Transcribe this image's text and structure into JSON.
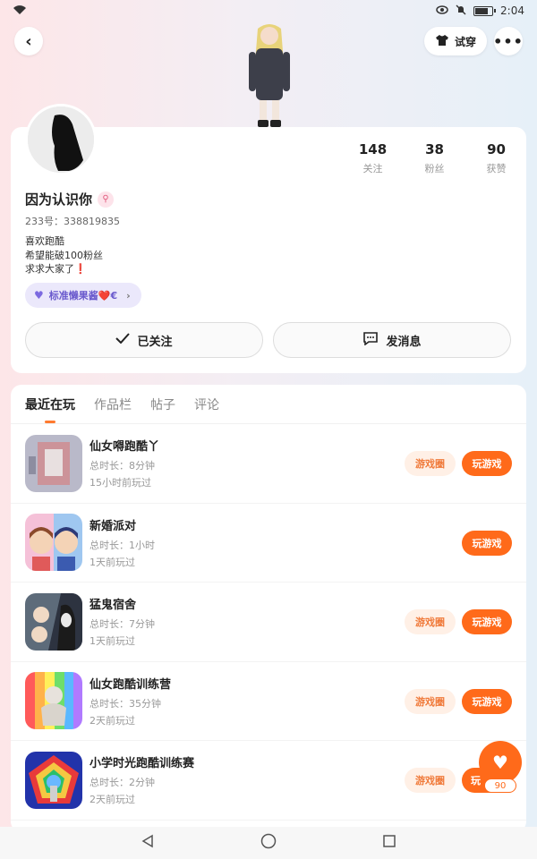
{
  "status_bar": {
    "time": "2:04",
    "wifi_icon": "wifi-icon",
    "eye_icon": "eye-icon",
    "mute_icon": "mute-icon"
  },
  "header": {
    "back_icon": "chevron-left-icon",
    "try_on_label": "试穿",
    "more_icon": "more-icon"
  },
  "profile": {
    "nickname": "因为认识你",
    "uid": "233号：338819835",
    "bio_lines": [
      "喜欢跑酷",
      "希望能破100粉丝",
      "求求大家了"
    ],
    "bio_excl": "❗",
    "title_badge": "标准懒果酱❤️€",
    "stats": [
      {
        "value": "148",
        "label": "关注"
      },
      {
        "value": "38",
        "label": "粉丝"
      },
      {
        "value": "90",
        "label": "获赞"
      }
    ],
    "follow_label": "已关注",
    "message_label": "发消息"
  },
  "tabs": [
    "最近在玩",
    "作品栏",
    "帖子",
    "评论"
  ],
  "games": [
    {
      "name": "仙女嘚跑酷丫",
      "duration": "总时长：8分钟",
      "last_played": "15小时前玩过",
      "circle_label": "游戏圈",
      "play_label": "玩游戏",
      "has_circle": true
    },
    {
      "name": "新婚派对",
      "duration": "总时长：1小时",
      "last_played": "1天前玩过",
      "circle_label": "",
      "play_label": "玩游戏",
      "has_circle": false
    },
    {
      "name": "猛鬼宿舍",
      "duration": "总时长：7分钟",
      "last_played": "1天前玩过",
      "circle_label": "游戏圈",
      "play_label": "玩游戏",
      "has_circle": true
    },
    {
      "name": "仙女跑酷训练营",
      "duration": "总时长：35分钟",
      "last_played": "2天前玩过",
      "circle_label": "游戏圈",
      "play_label": "玩游戏",
      "has_circle": true
    },
    {
      "name": "小学时光跑酷训练赛",
      "duration": "总时长：2分钟",
      "last_played": "2天前玩过",
      "circle_label": "游戏圈",
      "play_label": "玩",
      "has_circle": true
    }
  ],
  "floating_like": {
    "count": "90",
    "icon": "heart-icon"
  },
  "colors": {
    "accent": "#ff6a1a",
    "circle_bg": "#fff0e6",
    "title_pill_bg": "#ebe8fb"
  }
}
